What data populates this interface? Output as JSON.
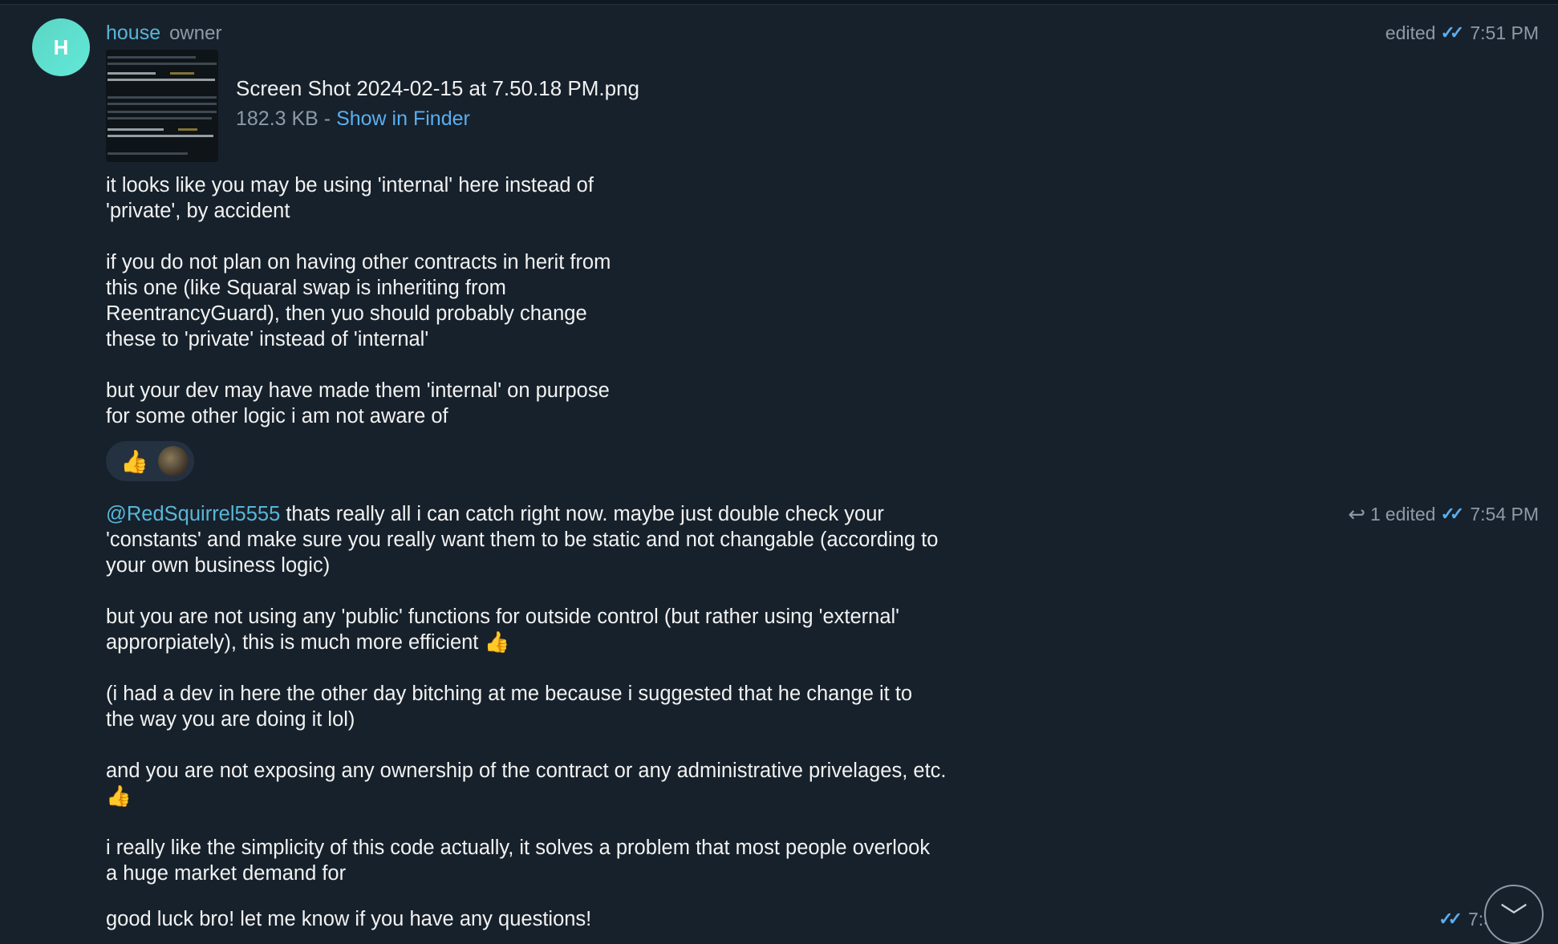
{
  "avatar": {
    "letter": "H"
  },
  "message1": {
    "sender": "house",
    "role": "owner",
    "edited": "edited",
    "time": "7:51 PM",
    "file": {
      "name": "Screen Shot 2024-02-15 at 7.50.18 PM.png",
      "size": "182.3 KB - ",
      "action": "Show in Finder"
    },
    "paragraphs": [
      "it looks like you may be using 'internal' here instead of\n'private', by accident",
      "if you do not plan on having other contracts in herit from\nthis one (like Squaral swap is inheriting from\nReentrancyGuard), then yuo should probably change\nthese to 'private' instead of 'internal'",
      "but your dev may have made them 'internal' on purpose\nfor some other logic i am not aware of"
    ],
    "reaction": "👍"
  },
  "message2": {
    "mention": "@RedSquirrel5555",
    "replies": "1",
    "edited": "edited",
    "time": "7:54 PM",
    "first_text": " thats really all i can catch right now. maybe just double check your\n'constants' and make sure you really want them to be static and not changable (according to\nyour own business logic)",
    "paragraphs": [
      "but you are not using any 'public' functions for outside control (but rather using 'external'\napprorpiately), this is much more efficient 👍",
      "(i had a dev in here the other day bitching at me because i suggested that he change it to\nthe way you are doing it lol)",
      "and you are not exposing any ownership of the contract or any administrative privelages, etc.\n👍",
      "i really like the simplicity of this code actually, it solves a problem that most people overlook\na huge market demand for"
    ]
  },
  "message3": {
    "text": "good luck bro! let me know if you have any questions!",
    "time": "7:5"
  },
  "icons": {
    "read_ticks": "double-check-icon",
    "reply": "reply-arrow-icon",
    "scroll": "chevron-down-icon"
  },
  "colors": {
    "background": "#17212b",
    "accent": "#58b6d8",
    "link": "#5aaef0",
    "muted": "#8d9aa7"
  }
}
